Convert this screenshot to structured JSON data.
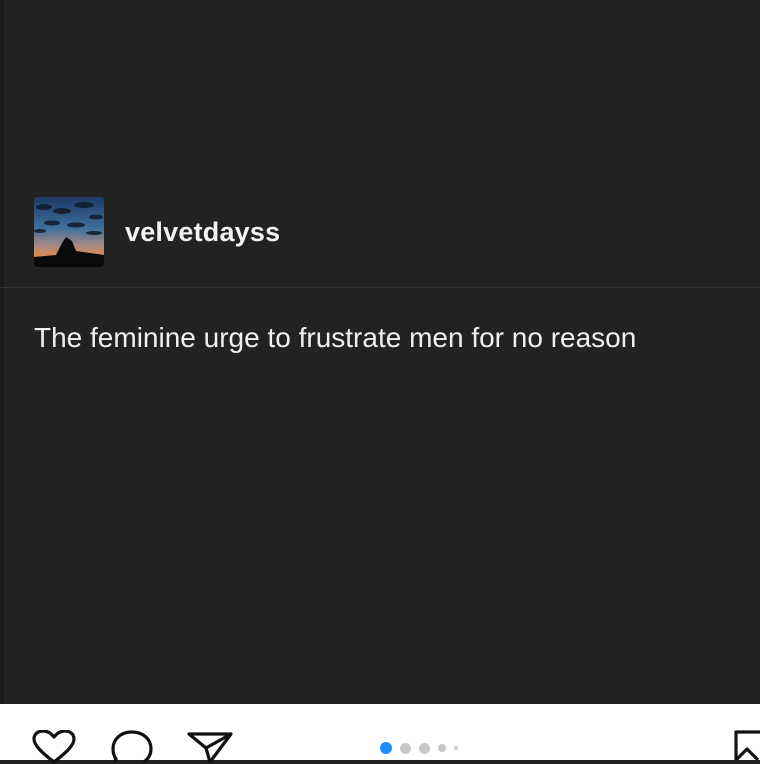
{
  "post": {
    "username": "velvetdayss",
    "text": "The feminine urge to frustrate men for no reason"
  },
  "avatar": {
    "icon": "sunset-sky-avatar"
  },
  "actions": {
    "like_icon": "heart-icon",
    "comment_icon": "comment-icon",
    "share_icon": "send-icon",
    "save_icon": "bookmark-icon"
  },
  "carousel": {
    "total_dots": 5,
    "active_index": 0,
    "active_color": "#1a8cff",
    "inactive_color": "#c8c8c8"
  },
  "colors": {
    "background": "#222223",
    "text": "#f0f0f0",
    "action_bar": "#ffffff"
  }
}
